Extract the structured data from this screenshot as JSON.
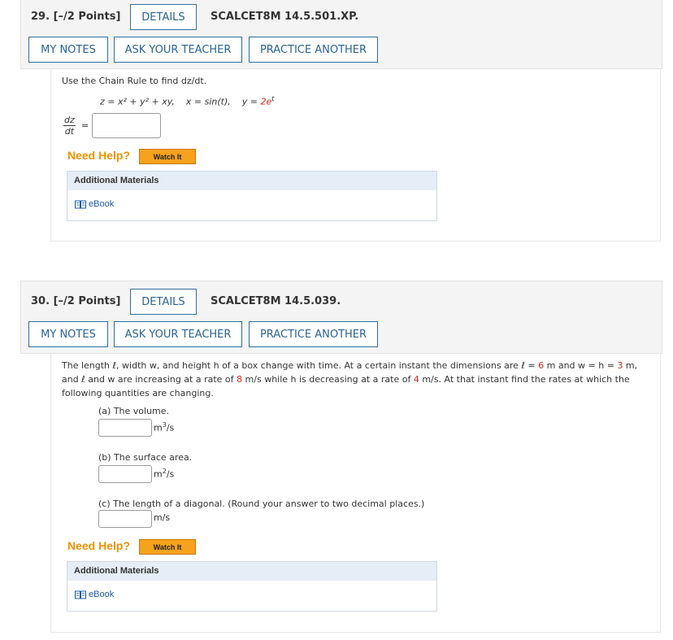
{
  "questions": [
    {
      "number": "29.",
      "points": "[–/2 Points]",
      "details_label": "DETAILS",
      "code": "SCALCET8M 14.5.501.XP.",
      "my_notes_label": "MY NOTES",
      "ask_teacher_label": "ASK YOUR TEACHER",
      "practice_label": "PRACTICE ANOTHER",
      "prompt": "Use the Chain Rule to find dz/dt.",
      "equation": {
        "z_part": "z = x² + y² + xy,",
        "x_part": "x = sin(t),",
        "y_prefix": "y = ",
        "y_coef": "2e",
        "y_exp": "t"
      },
      "answer_label_num": "dz",
      "answer_label_den": "dt",
      "answer_equals": "=",
      "answer_value": "",
      "need_help": "Need Help?",
      "watch_it": "Watch It",
      "additional_materials": "Additional Materials",
      "ebook": "eBook"
    },
    {
      "number": "30.",
      "points": "[–/2 Points]",
      "details_label": "DETAILS",
      "code": "SCALCET8M 14.5.039.",
      "my_notes_label": "MY NOTES",
      "ask_teacher_label": "ASK YOUR TEACHER",
      "practice_label": "PRACTICE ANOTHER",
      "para": {
        "l1_a": "The length ℓ, width w, and height h of a box change with time. At a certain instant the dimensions are ℓ = ",
        "l1_b": "6",
        "l1_c": " m and  w = h = ",
        "l1_d": "3",
        "l1_e": " m,",
        "l2_a": "and ℓ and w are increasing at a rate of ",
        "l2_b": "8",
        "l2_c": " m/s while h is decreasing at a rate of ",
        "l2_d": "4",
        "l2_e": " m/s. At that instant find the rates at which the",
        "l3": "following quantities are changing."
      },
      "parts": [
        {
          "label": "(a) The volume.",
          "unit_base": "m",
          "unit_exp": "3",
          "unit_tail": "/s",
          "value": ""
        },
        {
          "label": "(b) The surface area.",
          "unit_base": "m",
          "unit_exp": "2",
          "unit_tail": "/s",
          "value": ""
        },
        {
          "label": "(c) The length of a diagonal. (Round your answer to two decimal places.)",
          "unit_base": "m/s",
          "unit_exp": "",
          "unit_tail": "",
          "value": ""
        }
      ],
      "need_help": "Need Help?",
      "watch_it": "Watch It",
      "additional_materials": "Additional Materials",
      "ebook": "eBook"
    }
  ],
  "colors": {
    "accent_blue": "#2a6495",
    "need_help_orange": "#f29100",
    "given_value_red": "#d6281e"
  },
  "icons": {
    "ebook": "book-icon"
  }
}
